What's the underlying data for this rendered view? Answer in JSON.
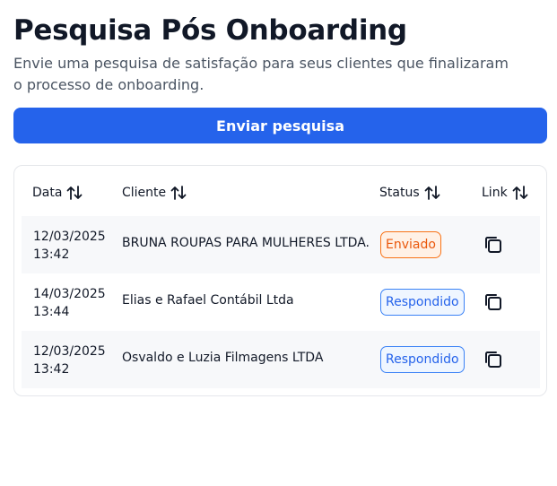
{
  "header": {
    "title": "Pesquisa Pós Onboarding",
    "description": "Envie uma pesquisa de satisfação para seus clientes que finalizaram o processo de onboarding."
  },
  "actions": {
    "send_label": "Enviar pesquisa",
    "send_color": "#2563eb"
  },
  "table": {
    "columns": [
      {
        "label": "Data",
        "icon": "sort-arrows-icon"
      },
      {
        "label": "Cliente",
        "icon": "sort-arrows-icon"
      },
      {
        "label": "Status",
        "icon": "sort-arrows-icon"
      },
      {
        "label": "Link",
        "icon": "sort-arrows-icon"
      }
    ],
    "rows": [
      {
        "date": "12/03/2025",
        "time": "13:42",
        "client": "BRUNA ROUPAS PARA MULHERES LTDA.",
        "status": "Enviado",
        "status_color": "#ea580c",
        "link_icon": "copy-icon"
      },
      {
        "date": "14/03/2025",
        "time": "13:44",
        "client": "Elias e Rafael Contábil Ltda",
        "status": "Respondido",
        "status_color": "#2563eb",
        "link_icon": "copy-icon"
      },
      {
        "date": "12/03/2025",
        "time": "13:42",
        "client": "Osvaldo e Luzia Filmagens LTDA",
        "status": "Respondido",
        "status_color": "#2563eb",
        "link_icon": "copy-icon"
      }
    ]
  }
}
